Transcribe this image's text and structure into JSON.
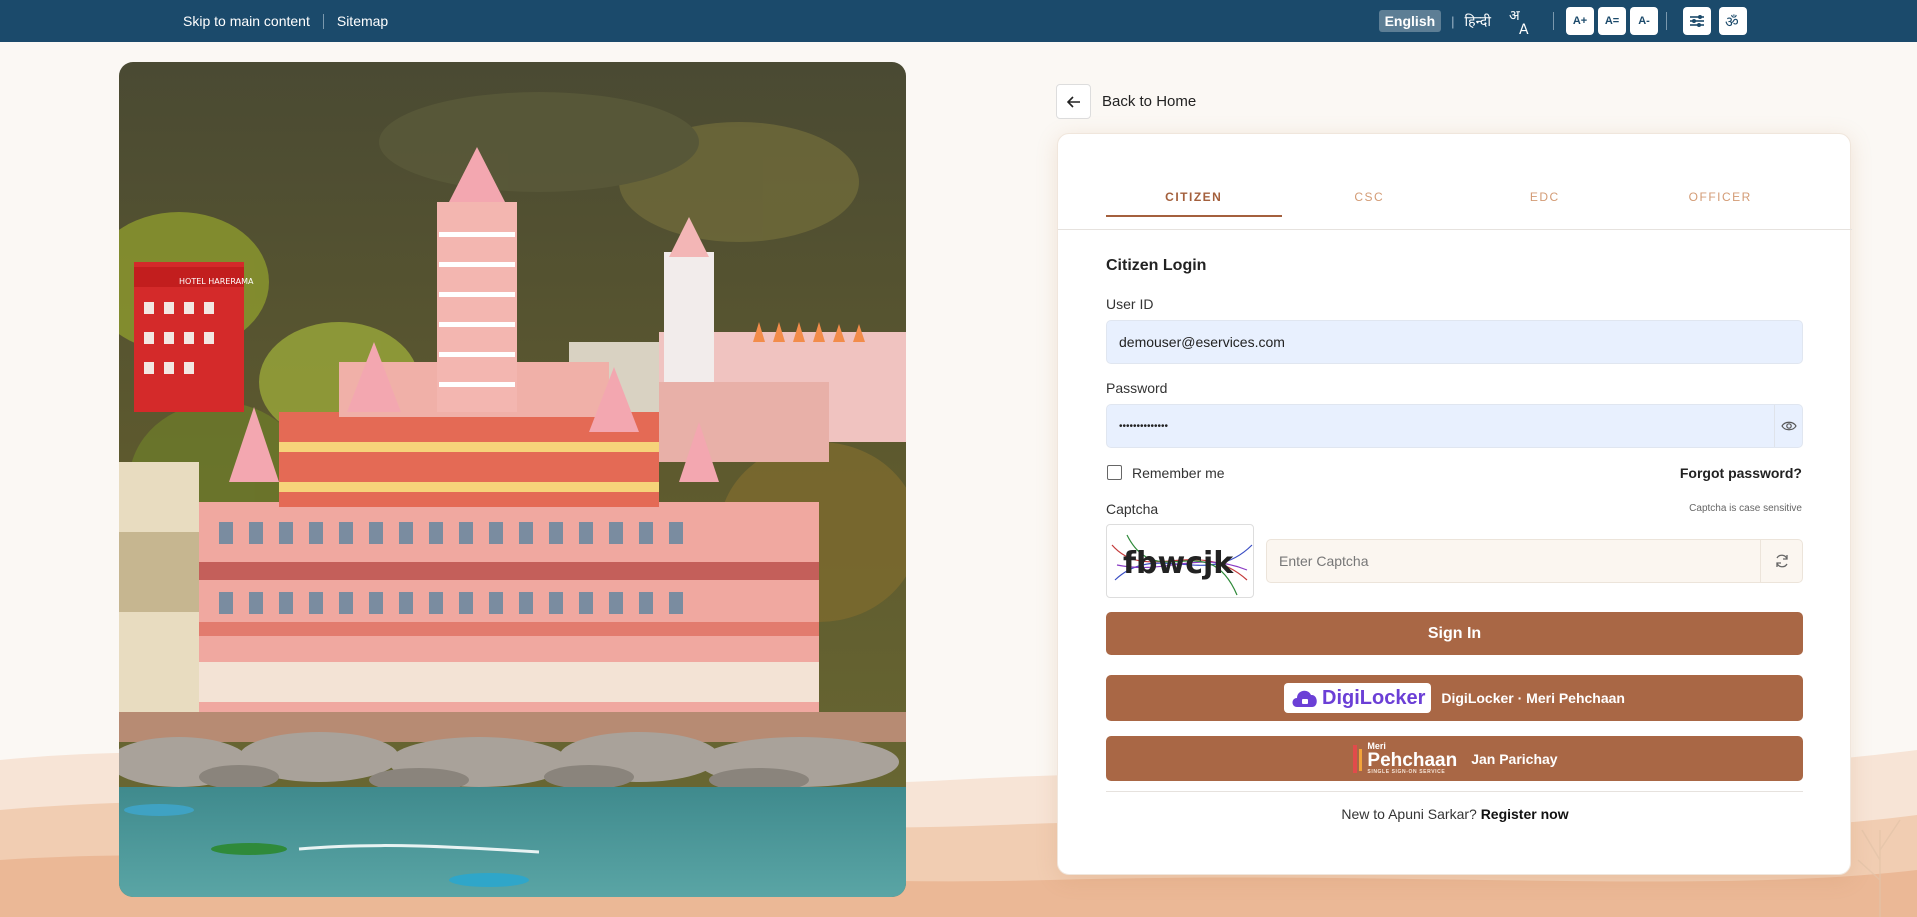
{
  "topbar": {
    "skip_link": "Skip to main content",
    "sitemap": "Sitemap",
    "lang_english": "English",
    "lang_hindi": "हिन्दी",
    "font_increase": "A+",
    "font_reset": "A=",
    "font_decrease": "A-"
  },
  "nav": {
    "back_label": "Back to Home"
  },
  "tabs": [
    "CITIZEN",
    "CSC",
    "EDC",
    "OFFICER"
  ],
  "form": {
    "title": "Citizen Login",
    "user_label": "User ID",
    "user_value": "demouser@eservices.com",
    "password_label": "Password",
    "password_value": "••••••••••••••",
    "remember": "Remember me",
    "forgot": "Forgot password?",
    "captcha_label": "Captcha",
    "captcha_note": "Captcha is case sensitive",
    "captcha_text": "fbwcjk",
    "captcha_placeholder": "Enter Captcha",
    "signin": "Sign In",
    "digilocker_logo": "DigiLocker",
    "digilocker_label": "DigiLocker · Meri Pehchaan",
    "meri_small": "Meri",
    "pehchaan_logo": "Pehchaan",
    "pehchaan_tagline": "SINGLE SIGN-ON SERVICE",
    "janparichay_label": "Jan Parichay",
    "register_prompt": "New to Apuni Sarkar?",
    "register_link": "Register now"
  },
  "photo": {
    "hotel_sign": "HOTEL HARERAMA"
  },
  "colors": {
    "topbar": "#1b4a6b",
    "accent": "#a96745",
    "tab_active": "#a4603d",
    "tab_inactive": "#d39b75"
  }
}
